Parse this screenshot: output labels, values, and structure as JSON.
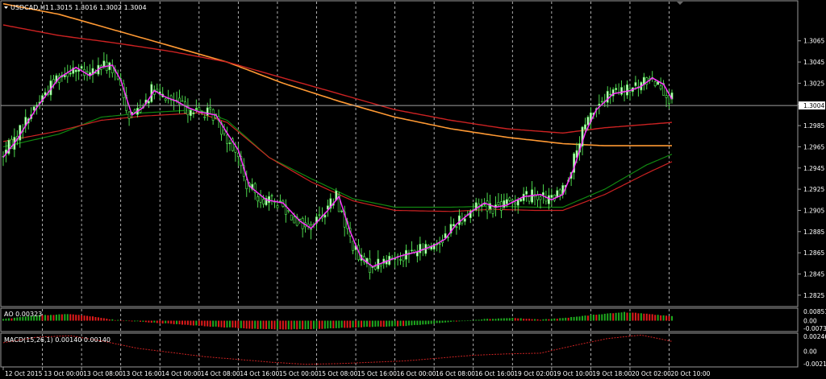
{
  "chart_data": [
    {
      "type": "candlestick",
      "title": "USDCAD,H1",
      "ohlc_readout": "1.3015 1.3016 1.3002 1.3004",
      "current_price_label": "1.3004",
      "current_price": 1.3004,
      "ylim": [
        1.2815,
        1.3102
      ],
      "y_ticks": [
        "1.3065",
        "1.3045",
        "1.3025",
        "1.3005",
        "1.2985",
        "1.2965",
        "1.2945",
        "1.2925",
        "1.2905",
        "1.2885",
        "1.2865",
        "1.2845",
        "1.2825"
      ],
      "x_ticks": [
        "12 Oct 2015",
        "13 Oct 00:00",
        "13 Oct 08:00",
        "13 Oct 16:00",
        "14 Oct 00:00",
        "14 Oct 08:00",
        "14 Oct 16:00",
        "15 Oct 00:00",
        "15 Oct 08:00",
        "15 Oct 16:00",
        "16 Oct 00:00",
        "16 Oct 08:00",
        "16 Oct 16:00",
        "19 Oct 02:00",
        "19 Oct 10:00",
        "19 Oct 18:00",
        "20 Oct 02:00",
        "20 Oct 10:00"
      ],
      "grid": true,
      "colors": {
        "background": "#000000",
        "bull_candle": "#ccffcc",
        "bear_candle": "#000000",
        "wick": "#55ee55",
        "grid": "#ffffff",
        "price_line": "#a0a0a0",
        "ma_fast": "#ff33ff",
        "ma_slow_red": "#cc2222",
        "ma_orange": "#ff9933",
        "ma_green": "#118811"
      },
      "ma_fast_knots": [
        [
          0,
          1.2955
        ],
        [
          5,
          1.2972
        ],
        [
          12,
          1.3002
        ],
        [
          20,
          1.303
        ],
        [
          26,
          1.304
        ],
        [
          31,
          1.3032
        ],
        [
          35,
          1.304
        ],
        [
          39,
          1.3042
        ],
        [
          42,
          1.3028
        ],
        [
          46,
          1.2995
        ],
        [
          50,
          1.3002
        ],
        [
          54,
          1.3018
        ],
        [
          58,
          1.3012
        ],
        [
          62,
          1.3008
        ],
        [
          66,
          1.3002
        ],
        [
          70,
          1.2998
        ],
        [
          76,
          1.2995
        ],
        [
          80,
          1.2978
        ],
        [
          84,
          1.2962
        ],
        [
          88,
          1.2928
        ],
        [
          94,
          1.2915
        ],
        [
          100,
          1.2912
        ],
        [
          106,
          1.2895
        ],
        [
          110,
          1.2888
        ],
        [
          116,
          1.2905
        ],
        [
          120,
          1.2918
        ],
        [
          124,
          1.2885
        ],
        [
          128,
          1.286
        ],
        [
          132,
          1.2852
        ],
        [
          138,
          1.2858
        ],
        [
          142,
          1.2862
        ],
        [
          148,
          1.2866
        ],
        [
          154,
          1.2872
        ],
        [
          158,
          1.2878
        ],
        [
          162,
          1.2892
        ],
        [
          168,
          1.2905
        ],
        [
          172,
          1.2912
        ],
        [
          176,
          1.2908
        ],
        [
          180,
          1.291
        ],
        [
          186,
          1.2918
        ],
        [
          192,
          1.292
        ],
        [
          196,
          1.2915
        ],
        [
          200,
          1.292
        ],
        [
          204,
          1.2945
        ],
        [
          208,
          1.2978
        ],
        [
          212,
          1.3
        ],
        [
          218,
          1.3015
        ],
        [
          224,
          1.3018
        ],
        [
          228,
          1.3022
        ],
        [
          232,
          1.303
        ],
        [
          236,
          1.3024
        ],
        [
          239,
          1.301
        ]
      ],
      "ma_red_a_knots": [
        [
          0,
          1.308
        ],
        [
          20,
          1.307
        ],
        [
          40,
          1.3063
        ],
        [
          60,
          1.3055
        ],
        [
          80,
          1.3045
        ],
        [
          100,
          1.303
        ],
        [
          120,
          1.3015
        ],
        [
          140,
          1.3
        ],
        [
          160,
          1.299
        ],
        [
          180,
          1.2982
        ],
        [
          200,
          1.2978
        ],
        [
          215,
          1.2983
        ],
        [
          239,
          1.2988
        ]
      ],
      "ma_orange_knots": [
        [
          0,
          1.31
        ],
        [
          20,
          1.309
        ],
        [
          40,
          1.3075
        ],
        [
          60,
          1.306
        ],
        [
          80,
          1.3045
        ],
        [
          100,
          1.3025
        ],
        [
          120,
          1.3008
        ],
        [
          140,
          1.2993
        ],
        [
          160,
          1.2982
        ],
        [
          180,
          1.2974
        ],
        [
          200,
          1.2968
        ],
        [
          215,
          1.2966
        ],
        [
          239,
          1.2966
        ]
      ],
      "ma_green_knots": [
        [
          0,
          1.2965
        ],
        [
          20,
          1.2977
        ],
        [
          35,
          1.2993
        ],
        [
          50,
          1.2997
        ],
        [
          70,
          1.3
        ],
        [
          80,
          1.299
        ],
        [
          95,
          1.2955
        ],
        [
          110,
          1.2935
        ],
        [
          125,
          1.2916
        ],
        [
          140,
          1.2908
        ],
        [
          160,
          1.2908
        ],
        [
          175,
          1.2909
        ],
        [
          190,
          1.2908
        ],
        [
          200,
          1.2908
        ],
        [
          215,
          1.2925
        ],
        [
          230,
          1.2948
        ],
        [
          239,
          1.2958
        ]
      ],
      "ma_red_b_knots": [
        [
          0,
          1.297
        ],
        [
          20,
          1.298
        ],
        [
          35,
          1.299
        ],
        [
          50,
          1.2994
        ],
        [
          70,
          1.2997
        ],
        [
          80,
          1.2988
        ],
        [
          95,
          1.2955
        ],
        [
          110,
          1.2932
        ],
        [
          125,
          1.2914
        ],
        [
          140,
          1.2905
        ],
        [
          160,
          1.2904
        ],
        [
          175,
          1.2906
        ],
        [
          190,
          1.2905
        ],
        [
          200,
          1.2905
        ],
        [
          215,
          1.292
        ],
        [
          230,
          1.294
        ],
        [
          239,
          1.2951
        ]
      ]
    },
    {
      "type": "histogram",
      "title": "AO 0.00323",
      "y_ticks": [
        "0.00851",
        "0.00",
        "-0.00732"
      ],
      "ylim": [
        -0.00732,
        0.00851
      ],
      "colors": {
        "up": "#1faa1f",
        "down": "#e11b1b"
      },
      "ao_knots": [
        [
          0,
          0.0012
        ],
        [
          12,
          0.0038
        ],
        [
          24,
          0.0048
        ],
        [
          32,
          0.003
        ],
        [
          40,
          0.0005
        ],
        [
          52,
          -0.0012
        ],
        [
          64,
          -0.0028
        ],
        [
          76,
          -0.0045
        ],
        [
          88,
          -0.0058
        ],
        [
          100,
          -0.0064
        ],
        [
          112,
          -0.006
        ],
        [
          122,
          -0.0052
        ],
        [
          132,
          -0.0045
        ],
        [
          142,
          -0.004
        ],
        [
          152,
          -0.0025
        ],
        [
          162,
          -0.0005
        ],
        [
          172,
          0.0012
        ],
        [
          182,
          0.002
        ],
        [
          192,
          0.0008
        ],
        [
          200,
          0.0018
        ],
        [
          212,
          0.0045
        ],
        [
          222,
          0.0062
        ],
        [
          230,
          0.005
        ],
        [
          239,
          0.0032
        ]
      ]
    },
    {
      "type": "line",
      "title": "MACD(15,26,1) 0.00140 0.00140",
      "y_ticks": [
        "0.00246",
        "0.00",
        "-0.00216"
      ],
      "ylim": [
        -0.00216,
        0.00246
      ],
      "colors": {
        "line": "#cc2222"
      },
      "macd_knots": [
        [
          0,
          0.0012
        ],
        [
          12,
          0.002
        ],
        [
          24,
          0.0022
        ],
        [
          36,
          0.0014
        ],
        [
          48,
          0.0004
        ],
        [
          60,
          -0.0002
        ],
        [
          72,
          -0.0008
        ],
        [
          84,
          -0.0012
        ],
        [
          96,
          -0.0016
        ],
        [
          108,
          -0.0019
        ],
        [
          120,
          -0.0018
        ],
        [
          132,
          -0.0016
        ],
        [
          144,
          -0.0014
        ],
        [
          156,
          -0.001
        ],
        [
          168,
          -0.0006
        ],
        [
          180,
          -0.0004
        ],
        [
          192,
          -0.0003
        ],
        [
          204,
          0.0008
        ],
        [
          216,
          0.0018
        ],
        [
          228,
          0.0023
        ],
        [
          239,
          0.0014
        ]
      ]
    }
  ]
}
